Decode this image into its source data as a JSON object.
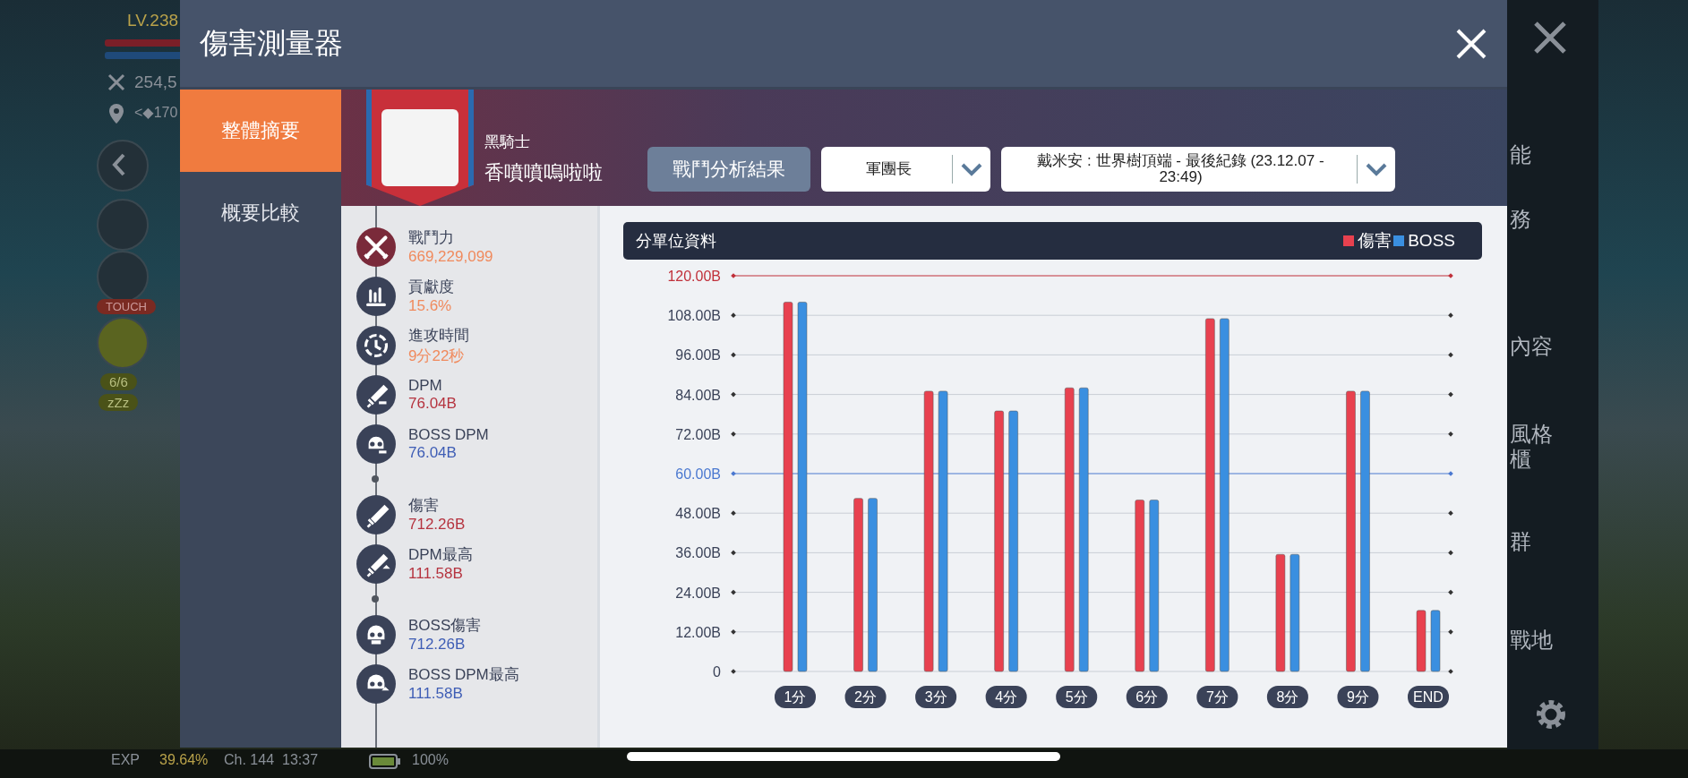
{
  "hud": {
    "level": "LV.238",
    "power": "254,5",
    "location": "<◆170",
    "touch_badge": "TOUCH",
    "count": "6/6",
    "sleep": "zZz"
  },
  "side_menu": [
    {
      "label": "能"
    },
    {
      "label": "務"
    },
    {
      "label": "內容"
    },
    {
      "label": "風格"
    },
    {
      "label": "櫃"
    },
    {
      "label": "群"
    },
    {
      "label": "戰地"
    }
  ],
  "status_bar": {
    "exp_label": "EXP",
    "exp": "39.64%",
    "channel": "Ch. 144",
    "time": "13:37",
    "battery": "100%"
  },
  "window": {
    "title": "傷害測量器"
  },
  "tabs": [
    {
      "label": "整體摘要",
      "selected": true
    },
    {
      "label": "概要比較",
      "selected": false
    }
  ],
  "profile": {
    "class": "黑騎士",
    "name": "香噴噴嗚啦啦"
  },
  "toolbar": {
    "button": "戰鬥分析結果",
    "dropdowns": [
      {
        "value": "軍團長"
      },
      {
        "value": "戴米安 : 世界樹頂端 - 最後紀錄 (23.12.07 -\n23:49)"
      }
    ]
  },
  "stats": [
    {
      "items": [
        {
          "kind": "power",
          "label": "戰鬥力",
          "value": "669,229,099",
          "color": "#f08a5d"
        },
        {
          "kind": "share",
          "label": "貢獻度",
          "value": "15.6%",
          "color": "#f08a5d"
        },
        {
          "kind": "time",
          "label": "進攻時間",
          "value": "9分22秒",
          "color": "#f08a5d"
        },
        {
          "kind": "dpm",
          "label": "DPM",
          "value": "76.04B",
          "color": "#b5333f"
        },
        {
          "kind": "bossdpm",
          "label": "BOSS DPM",
          "value": "76.04B",
          "color": "#3e5db5"
        }
      ]
    },
    {
      "items": [
        {
          "kind": "damage",
          "label": "傷害",
          "value": "712.26B",
          "color": "#b5333f"
        },
        {
          "kind": "dpmmax",
          "label": "DPM最高",
          "value": "111.58B",
          "color": "#b5333f"
        }
      ]
    },
    {
      "items": [
        {
          "kind": "bossdamage",
          "label": "BOSS傷害",
          "value": "712.26B",
          "color": "#3e5db5"
        },
        {
          "kind": "bossdpmmax",
          "label": "BOSS DPM最高",
          "value": "111.58B",
          "color": "#3e5db5"
        }
      ]
    }
  ],
  "chart": {
    "chart_data": {
      "type": "bar",
      "title": "分單位資料",
      "categories": [
        "1分",
        "2分",
        "3分",
        "4分",
        "5分",
        "6分",
        "7分",
        "8分",
        "9分",
        "END"
      ],
      "series": [
        {
          "name": "傷害",
          "color": "#e8414f",
          "values": [
            112,
            52.5,
            85,
            79,
            86,
            52,
            107,
            35.5,
            85,
            18.5
          ]
        },
        {
          "name": "BOSS",
          "color": "#3a8fe0",
          "values": [
            112,
            52.5,
            85,
            79,
            86,
            52,
            107,
            35.5,
            85,
            18.5
          ]
        }
      ],
      "grid": true,
      "ylim": [
        0,
        120
      ],
      "yticks": [
        {
          "value": 0,
          "label": "0"
        },
        {
          "value": 12,
          "label": "12.00B"
        },
        {
          "value": 24,
          "label": "24.00B"
        },
        {
          "value": 36,
          "label": "36.00B"
        },
        {
          "value": 48,
          "label": "48.00B"
        },
        {
          "value": 60,
          "label": "60.00B"
        },
        {
          "value": 72,
          "label": "72.00B"
        },
        {
          "value": 84,
          "label": "84.00B"
        },
        {
          "value": 96,
          "label": "96.00B"
        },
        {
          "value": 108,
          "label": "108.00B"
        },
        {
          "value": 120,
          "label": "120.00B"
        }
      ],
      "ref_lines": [
        {
          "axis": "y",
          "value": 120,
          "color": "#c0303a"
        },
        {
          "axis": "y",
          "value": 60,
          "color": "#4a78d0"
        }
      ]
    }
  }
}
